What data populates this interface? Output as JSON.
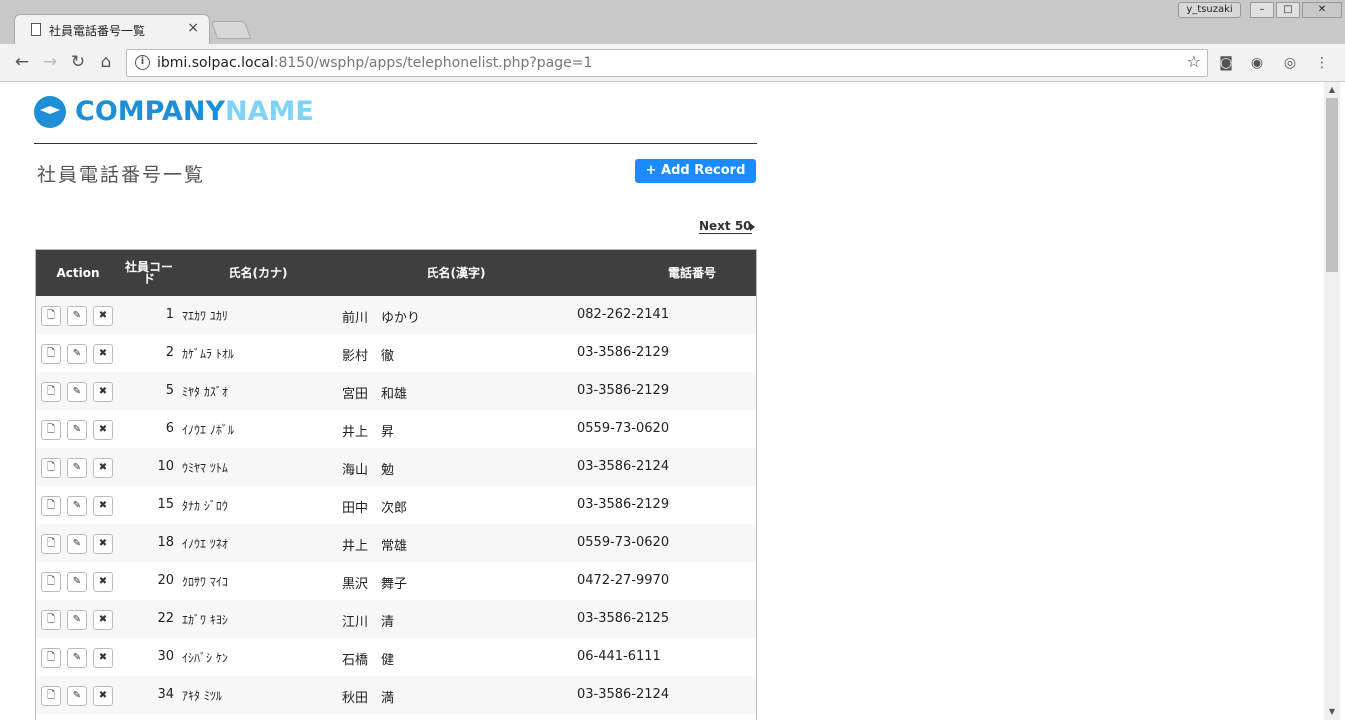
{
  "browser": {
    "tab_title": "社員電話番号一覧",
    "tab_close": "×",
    "user": "y_tsuzaki",
    "url_host": "ibmi.solpac.local",
    "url_rest": ":8150/wsphp/apps/telephonelist.php?page=1"
  },
  "page": {
    "logo_part1": "COMPANY",
    "logo_part2": "NAME",
    "title": "社員電話番号一覧",
    "add_button": "+ Add Record",
    "next_link": "Next 50"
  },
  "table": {
    "headers": [
      "Action",
      "社員コード",
      "氏名(カナ)",
      "氏名(漢字)",
      "電話番号"
    ],
    "rows": [
      {
        "code": "1",
        "kana": "ﾏｴｶﾜ ﾕｶﾘ",
        "kanji": "前川　ゆかり",
        "tel": "082-262-2141"
      },
      {
        "code": "2",
        "kana": "ｶｹﾞﾑﾗ ﾄｵﾙ",
        "kanji": "影村　徹",
        "tel": "03-3586-2129"
      },
      {
        "code": "5",
        "kana": "ﾐﾔﾀ ｶｽﾞｵ",
        "kanji": "宮田　和雄",
        "tel": "03-3586-2129"
      },
      {
        "code": "6",
        "kana": "ｲﾉｳｴ ﾉﾎﾞﾙ",
        "kanji": "井上　昇",
        "tel": "0559-73-0620"
      },
      {
        "code": "10",
        "kana": "ｳﾐﾔﾏ ﾂﾄﾑ",
        "kanji": "海山　勉",
        "tel": "03-3586-2124"
      },
      {
        "code": "15",
        "kana": "ﾀﾅｶ ｼﾞﾛｳ",
        "kanji": "田中　次郎",
        "tel": "03-3586-2129"
      },
      {
        "code": "18",
        "kana": "ｲﾉｳｴ ﾂﾈｵ",
        "kanji": "井上　常雄",
        "tel": "0559-73-0620"
      },
      {
        "code": "20",
        "kana": "ｸﾛｻﾜ ﾏｲｺ",
        "kanji": "黒沢　舞子",
        "tel": "0472-27-9970"
      },
      {
        "code": "22",
        "kana": "ｴｶﾞﾜ ｷﾖｼ",
        "kanji": "江川　清",
        "tel": "03-3586-2125"
      },
      {
        "code": "30",
        "kana": "ｲｼﾊﾞｼ ｹﾝ",
        "kanji": "石橋　健",
        "tel": "06-441-6111"
      },
      {
        "code": "34",
        "kana": "ｱｷﾀ ﾐﾂﾙ",
        "kanji": "秋田　満",
        "tel": "03-3586-2124"
      }
    ]
  },
  "icons": {
    "display": "🗋",
    "edit": "✎",
    "delete": "✖"
  },
  "colors": {
    "accent": "#1a8cff",
    "logo_dark": "#1e8fd6",
    "logo_light": "#7fd3f5",
    "header_bg": "#3f3f3f"
  }
}
